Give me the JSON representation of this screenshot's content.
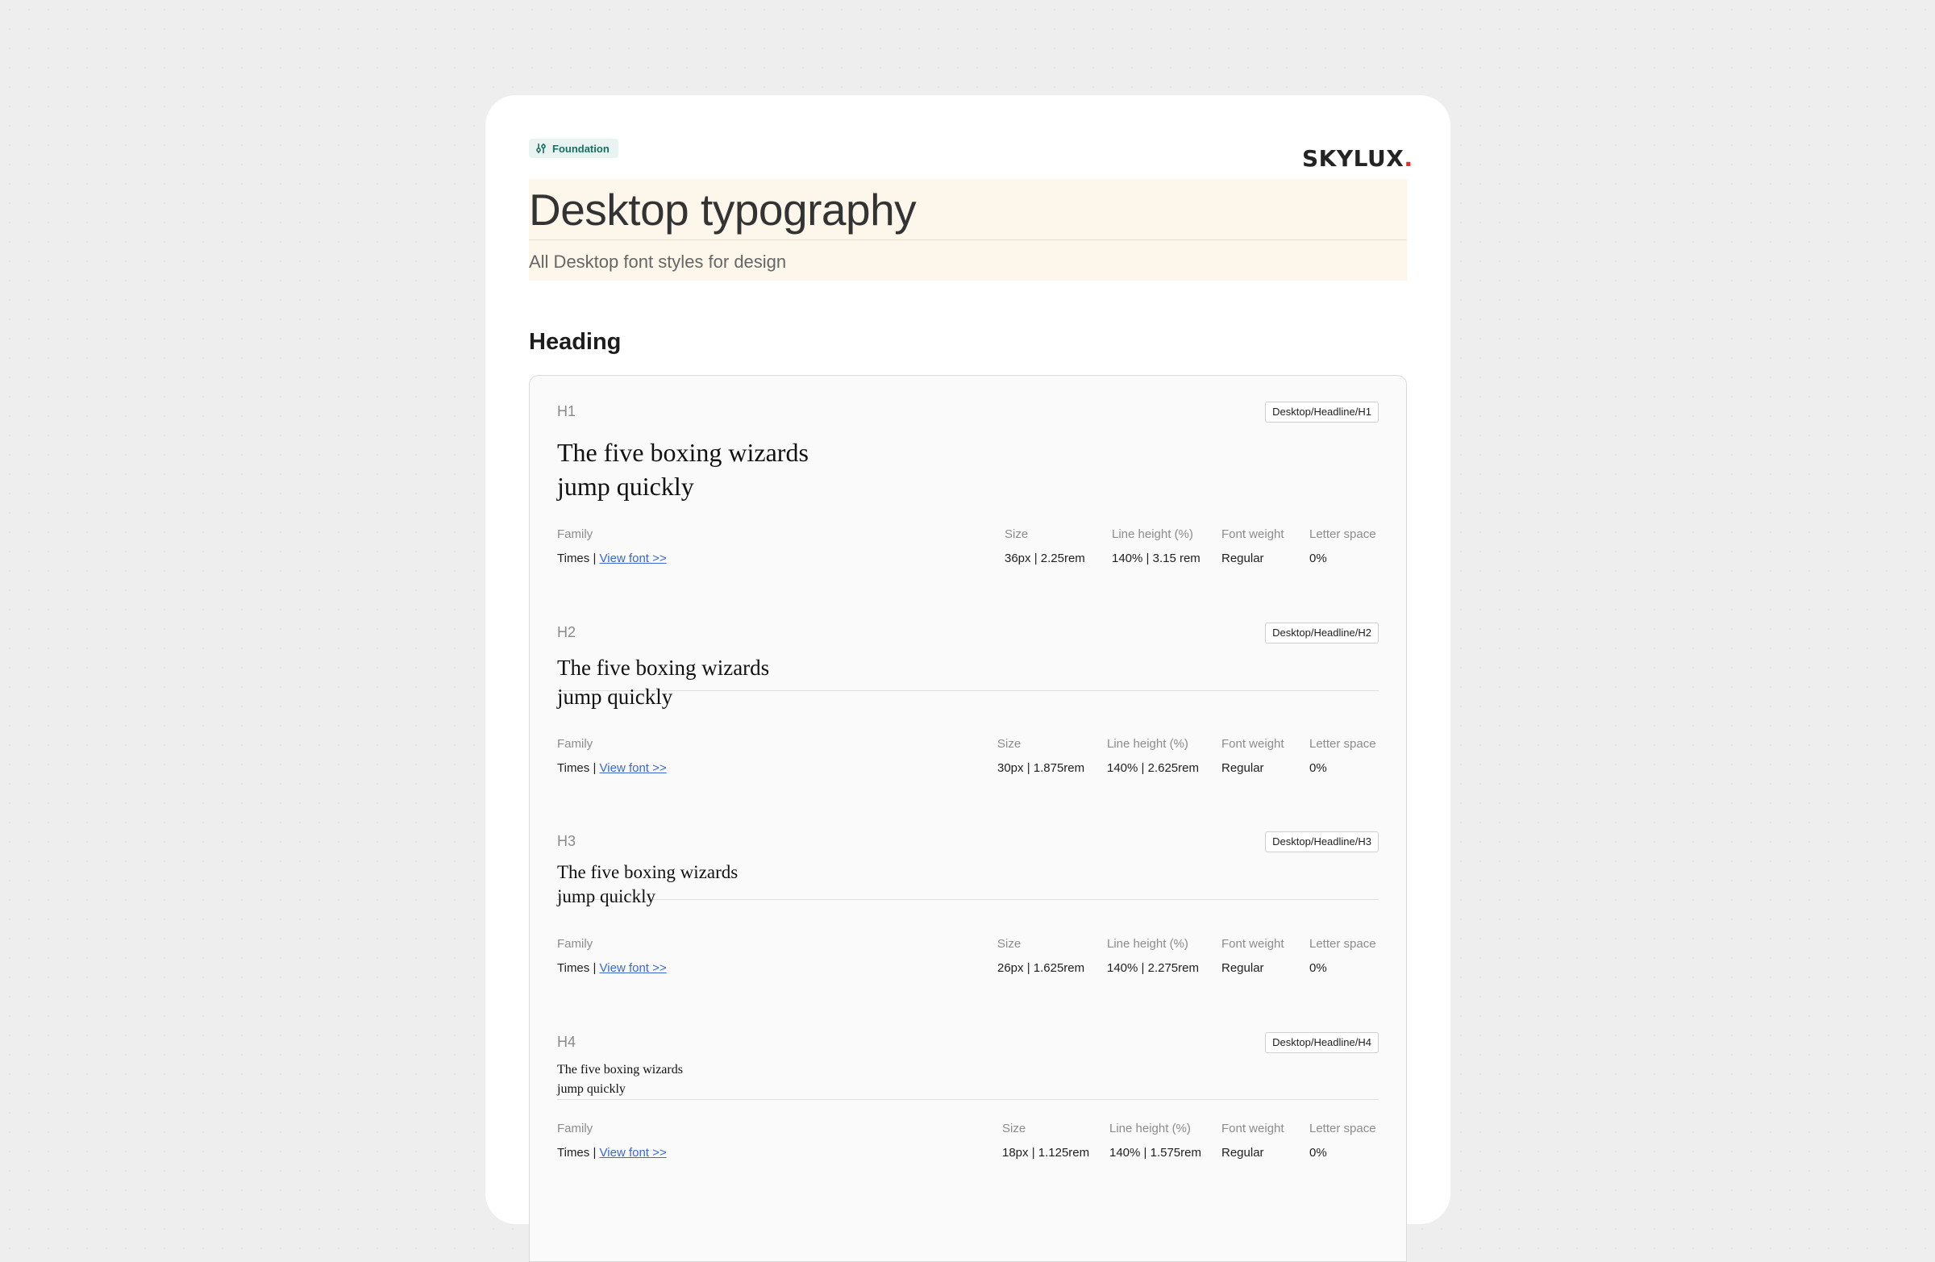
{
  "header": {
    "tag_label": "Foundation",
    "tag_icon": "settings-sliders-icon",
    "logo_text": "SKYLUX",
    "logo_dot": ".",
    "brand_color": "#d9322b",
    "title": "Desktop typography",
    "subtitle": "All Desktop font styles for design"
  },
  "section": {
    "title": "Heading"
  },
  "meta_labels": {
    "family": "Family",
    "size": "Size",
    "line_height": "Line height (%)",
    "font_weight": "Font weight",
    "letter_space": "Letter space"
  },
  "styles": [
    {
      "level": "H1",
      "token": "Desktop/Headline/H1",
      "sample_line1": "The five boxing wizards",
      "sample_line2": "jump quickly",
      "family": "Times",
      "family_sep": "|",
      "link": "View font >>",
      "size": "36px | 2.25rem",
      "line_height": "140% | 3.15 rem",
      "weight": "Regular",
      "letter_space": "0%"
    },
    {
      "level": "H2",
      "token": "Desktop/Headline/H2",
      "sample_line1": "The five boxing wizards",
      "sample_line2": "jump quickly",
      "family": "Times",
      "family_sep": "|",
      "link": "View font >>",
      "size": "30px | 1.875rem",
      "line_height": "140% | 2.625rem",
      "weight": "Regular",
      "letter_space": "0%"
    },
    {
      "level": "H3",
      "token": "Desktop/Headline/H3",
      "sample_line1": "The five boxing wizards",
      "sample_line2": "jump quickly",
      "family": "Times",
      "family_sep": "|",
      "link": "View font >>",
      "size": "26px | 1.625rem",
      "line_height": "140% | 2.275rem",
      "weight": "Regular",
      "letter_space": "0%"
    },
    {
      "level": "H4",
      "token": "Desktop/Headline/H4",
      "sample_line1": "The five boxing wizards",
      "sample_line2": "jump quickly",
      "family": "Times",
      "family_sep": "|",
      "link": "View font >>",
      "size": "18px | 1.125rem",
      "line_height": "140% | 1.575rem",
      "weight": "Regular",
      "letter_space": "0%"
    }
  ]
}
